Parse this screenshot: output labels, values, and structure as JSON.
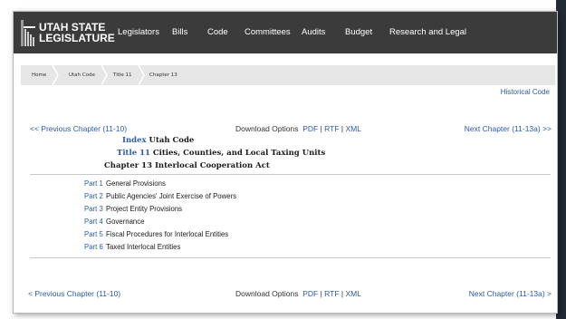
{
  "logo": {
    "line1": "UTAH STATE",
    "line2": "LEGISLATURE"
  },
  "nav": [
    "Legislators",
    "Bills",
    "Code",
    "Committees",
    "Audits",
    "Budget",
    "Research and Legal"
  ],
  "breadcrumb": [
    "Home",
    "Utah Code",
    "Title 11",
    "Chapter 13"
  ],
  "historical_code": "Historical Code",
  "top_nav": {
    "prev": "<< Previous Chapter (11-10)",
    "next": "Next Chapter (11-13a) >>",
    "download_label": "Download Options",
    "pdf": "PDF",
    "rtf": "RTF",
    "xml": "XML",
    "sep": "|"
  },
  "bottom_nav": {
    "prev": "< Previous Chapter (11-10)",
    "next": "Next Chapter (11-13a) >",
    "download_label": "Download Options",
    "pdf": "PDF",
    "rtf": "RTF",
    "xml": "XML",
    "sep": "|"
  },
  "heading": {
    "index_link": "Index",
    "index_text": "Utah Code",
    "title_link": "Title 11",
    "title_text": "Cities, Counties, and Local Taxing Units",
    "chapter_text": "Chapter 13 Interlocal Cooperation Act"
  },
  "parts": [
    {
      "label": "Part 1",
      "title": "General Provisions"
    },
    {
      "label": "Part 2",
      "title": "Public Agencies' Joint Exercise of Powers"
    },
    {
      "label": "Part 3",
      "title": "Project Entity Provisions"
    },
    {
      "label": "Part 4",
      "title": "Governance"
    },
    {
      "label": "Part 5",
      "title": "Fiscal Procedures for Interlocal Entities"
    },
    {
      "label": "Part 6",
      "title": "Taxed Interlocal Entities"
    }
  ]
}
